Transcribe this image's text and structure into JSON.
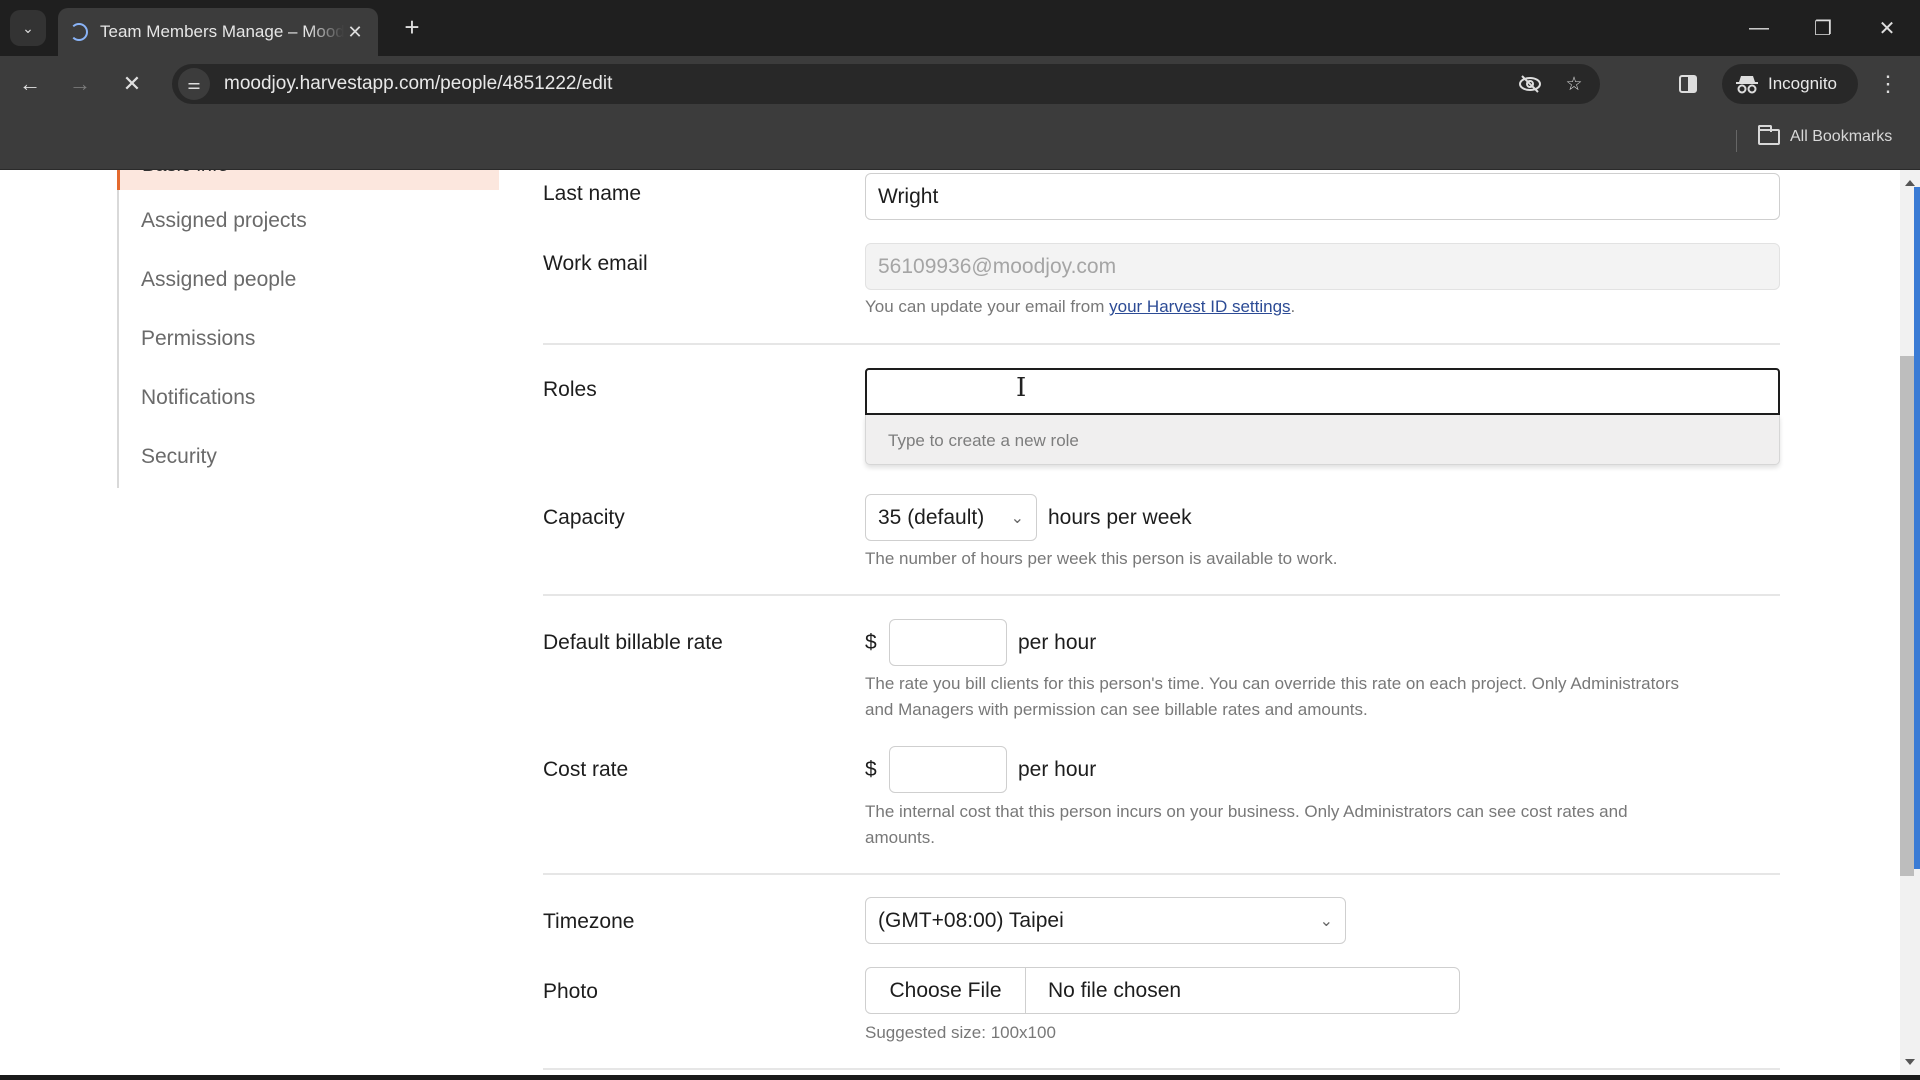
{
  "browser": {
    "tab_title": "Team Members Manage – Moodjoy",
    "url": "moodjoy.harvestapp.com/people/4851222/edit",
    "incognito_label": "Incognito",
    "all_bookmarks_label": "All Bookmarks",
    "icons": {
      "tab_list": "chevron-down-icon",
      "loading": "spinner-icon",
      "tab_close": "close-icon",
      "new_tab": "plus-icon",
      "minimize": "minimize-icon",
      "restore": "restore-icon",
      "close_window": "close-icon",
      "back": "arrow-left-icon",
      "forward": "arrow-right-icon",
      "stop": "stop-icon",
      "site_info": "tune-icon",
      "tracking": "eye-off-icon",
      "bookmark": "star-icon",
      "side_panel": "side-panel-icon",
      "incognito": "incognito-icon",
      "menu": "kebab-icon",
      "folder": "folder-icon"
    },
    "glyphs": {
      "tab_list": "⌄",
      "tab_close": "✕",
      "new_tab": "+",
      "minimize": "—",
      "restore": "❐",
      "close_window": "✕",
      "back": "←",
      "forward": "→",
      "stop": "✕",
      "site_info": "⚌",
      "tracking": "◌",
      "bookmark": "☆",
      "incognito": "🕶",
      "menu": "⋮"
    }
  },
  "sidebar": {
    "active_item": "Basic info",
    "items": [
      {
        "label": "Assigned projects"
      },
      {
        "label": "Assigned people"
      },
      {
        "label": "Permissions"
      },
      {
        "label": "Notifications"
      },
      {
        "label": "Security"
      }
    ]
  },
  "form": {
    "last_name": {
      "label": "Last name",
      "value": "Wright"
    },
    "work_email": {
      "label": "Work email",
      "value": "56109936@moodjoy.com",
      "hint_prefix": "You can update your email from ",
      "hint_link": "your Harvest ID settings",
      "hint_suffix": "."
    },
    "roles": {
      "label": "Roles",
      "value": "",
      "dropdown_hint": "Type to create a new role"
    },
    "capacity": {
      "label": "Capacity",
      "selected": "35 (default)",
      "unit": "hours per week",
      "hint": "The number of hours per week this person is available to work."
    },
    "billable_rate": {
      "label": "Default billable rate",
      "currency": "$",
      "value": "",
      "unit": "per hour",
      "hint_line1": "The rate you bill clients for this person's time. You can override this rate on each project. Only Administrators",
      "hint_line2": "and Managers with permission can see billable rates and amounts."
    },
    "cost_rate": {
      "label": "Cost rate",
      "currency": "$",
      "value": "",
      "unit": "per hour",
      "hint_line1": "The internal cost that this person incurs on your business. Only Administrators can see cost rates and",
      "hint_line2": "amounts."
    },
    "timezone": {
      "label": "Timezone",
      "selected": "(GMT+08:00) Taipei"
    },
    "photo": {
      "label": "Photo",
      "button_label": "Choose File",
      "status": "No file chosen",
      "hint": "Suggested size: 100x100"
    }
  },
  "colors": {
    "accent": "#e46a2e",
    "active_bg": "#fce7de",
    "link": "#2c4b95"
  }
}
